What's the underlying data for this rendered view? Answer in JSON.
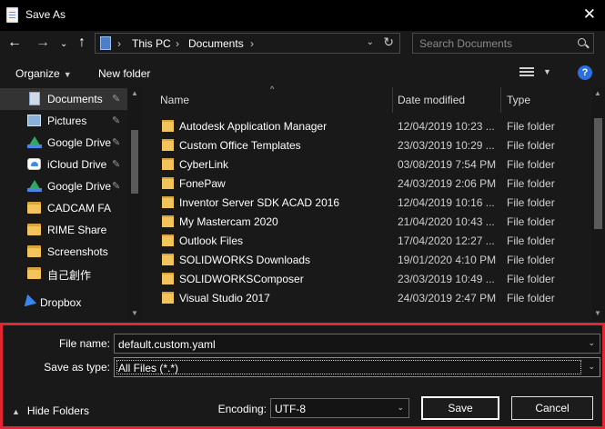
{
  "window": {
    "title": "Save As",
    "close_glyph": "✕"
  },
  "nav": {
    "back_glyph": "←",
    "forward_glyph": "→",
    "recent_glyph": "⌄",
    "up_glyph": "↑",
    "address": {
      "segments": [
        "This PC",
        "Documents"
      ],
      "separator": "›",
      "refresh_glyph": "↻",
      "dropdown_glyph": "⌄"
    },
    "search_placeholder": "Search Documents"
  },
  "toolbar": {
    "organize_label": "Organize",
    "new_folder_label": "New folder",
    "help_label": "?"
  },
  "sidebar": {
    "items": [
      {
        "label": "Documents",
        "icon": "document-icon",
        "pinned": true,
        "selected": true
      },
      {
        "label": "Pictures",
        "icon": "pictures-icon",
        "pinned": true
      },
      {
        "label": "Google Drive",
        "icon": "google-drive-icon",
        "pinned": true
      },
      {
        "label": "iCloud Drive",
        "icon": "icloud-drive-icon",
        "pinned": true
      },
      {
        "label": "Google Drive",
        "icon": "google-drive-icon",
        "pinned": true
      },
      {
        "label": "CADCAM FA",
        "icon": "folder-icon"
      },
      {
        "label": "RIME Share",
        "icon": "folder-icon"
      },
      {
        "label": "Screenshots",
        "icon": "folder-icon"
      },
      {
        "label": "自己創作",
        "icon": "folder-icon"
      },
      {
        "label": "Dropbox",
        "icon": "dropbox-icon"
      }
    ],
    "pin_glyph": "📌"
  },
  "filelist": {
    "columns": [
      "Name",
      "Date modified",
      "Type"
    ],
    "sort_glyph": "^",
    "rows": [
      {
        "name": "Autodesk Application Manager",
        "date": "12/04/2019 10:23 ...",
        "type": "File folder"
      },
      {
        "name": "Custom Office Templates",
        "date": "23/03/2019 10:29 ...",
        "type": "File folder"
      },
      {
        "name": "CyberLink",
        "date": "03/08/2019 7:54 PM",
        "type": "File folder"
      },
      {
        "name": "FonePaw",
        "date": "24/03/2019 2:06 PM",
        "type": "File folder"
      },
      {
        "name": "Inventor Server SDK ACAD 2016",
        "date": "12/04/2019 10:16 ...",
        "type": "File folder"
      },
      {
        "name": "My Mastercam 2020",
        "date": "21/04/2020 10:43 ...",
        "type": "File folder"
      },
      {
        "name": "Outlook Files",
        "date": "17/04/2020 12:27 ...",
        "type": "File folder"
      },
      {
        "name": "SOLIDWORKS Downloads",
        "date": "19/01/2020 4:10 PM",
        "type": "File folder"
      },
      {
        "name": "SOLIDWORKSComposer",
        "date": "23/03/2019 10:49 ...",
        "type": "File folder"
      },
      {
        "name": "Visual Studio 2017",
        "date": "24/03/2019 2:47 PM",
        "type": "File folder"
      }
    ]
  },
  "form": {
    "file_name_label": "File name:",
    "file_name_value": "default.custom.yaml",
    "save_type_label": "Save as type:",
    "save_type_value": "All Files  (*.*)",
    "encoding_label": "Encoding:",
    "encoding_value": "UTF-8",
    "save_label": "Save",
    "cancel_label": "Cancel",
    "hide_folders_label": "Hide Folders",
    "dropdown_glyph": "⌄",
    "hide_glyph": "^"
  },
  "colors": {
    "highlight_border": "#e32631",
    "folder": "#f2c45b",
    "background": "#191919"
  }
}
